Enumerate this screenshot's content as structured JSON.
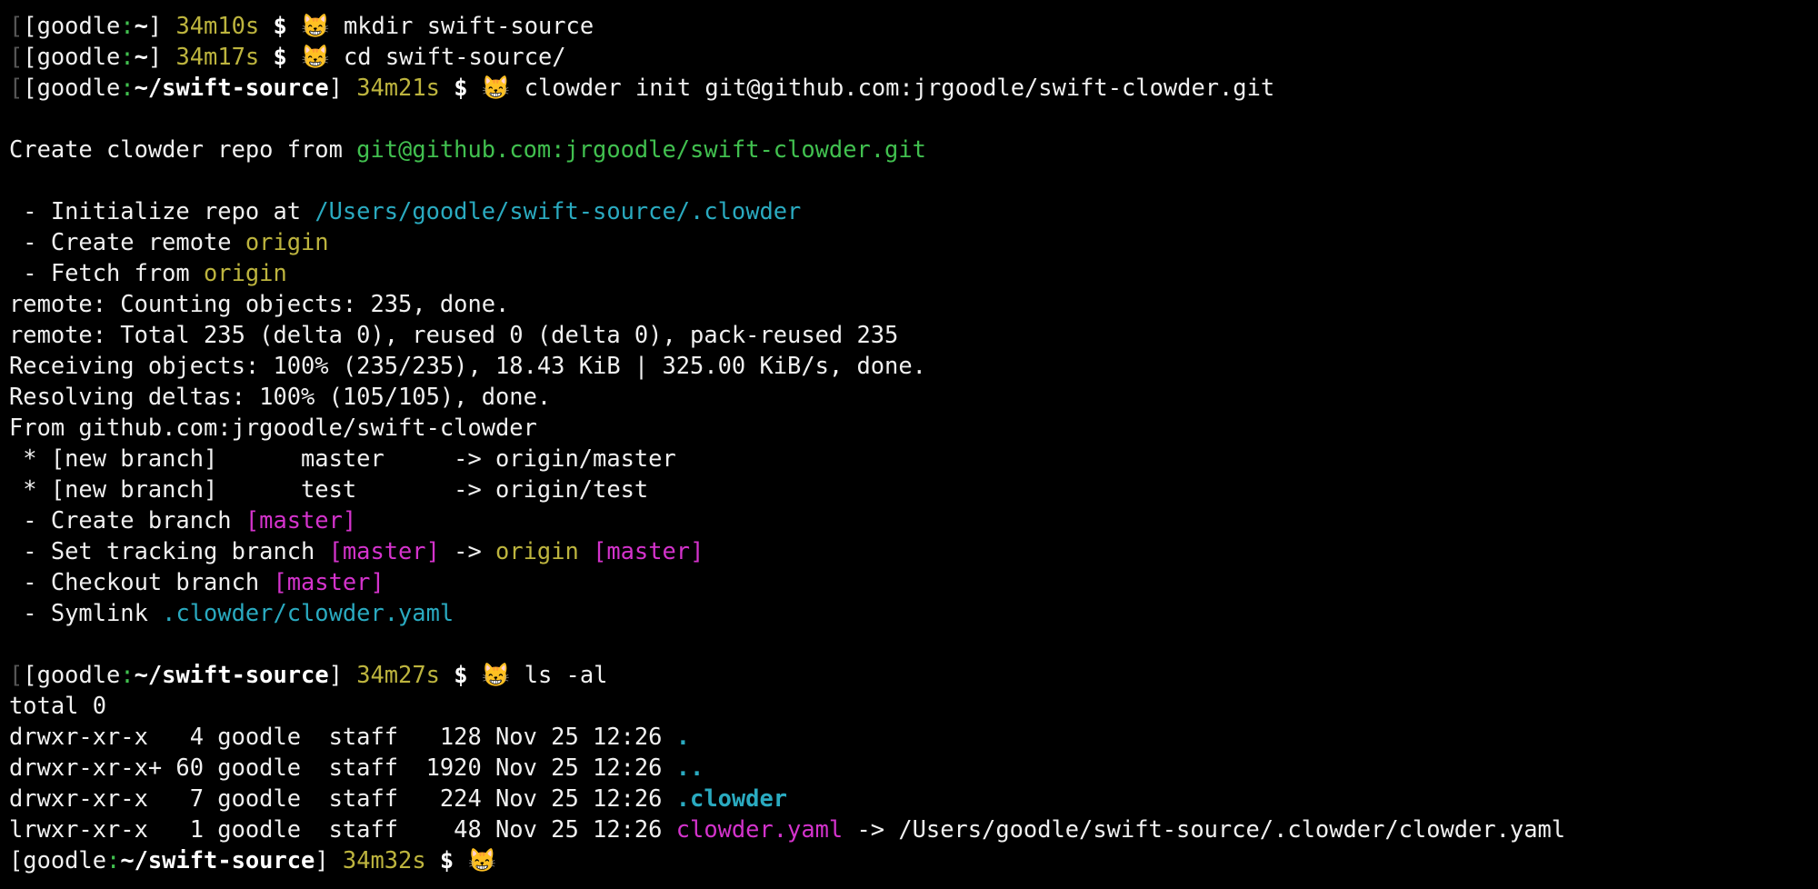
{
  "colors": {
    "background": "#000000",
    "foreground": "#f0f0f0",
    "green": "#41c04f",
    "yellow": "#bdb43e",
    "teal": "#2aaac0",
    "magenta": "#d433cc",
    "emoji": "#f2b520"
  },
  "lines": [
    [
      {
        "t": "[",
        "c": "dim"
      },
      {
        "t": "[goodle",
        "c": "w"
      },
      {
        "t": ":",
        "c": "g"
      },
      {
        "t": "~",
        "c": "wb"
      },
      {
        "t": "] ",
        "c": "w"
      },
      {
        "t": "34m10s",
        "c": "y"
      },
      {
        "t": " $ ",
        "c": "wb"
      },
      {
        "t": "😸",
        "c": "emoji",
        "icon": "grinning-cat-icon"
      },
      {
        "t": " mkdir swift-source",
        "c": "w"
      }
    ],
    [
      {
        "t": "[",
        "c": "dim"
      },
      {
        "t": "[goodle",
        "c": "w"
      },
      {
        "t": ":",
        "c": "g"
      },
      {
        "t": "~",
        "c": "wb"
      },
      {
        "t": "] ",
        "c": "w"
      },
      {
        "t": "34m17s",
        "c": "y"
      },
      {
        "t": " $ ",
        "c": "wb"
      },
      {
        "t": "😸",
        "c": "emoji",
        "icon": "grinning-cat-icon"
      },
      {
        "t": " cd swift-source/",
        "c": "w"
      }
    ],
    [
      {
        "t": "[",
        "c": "dim"
      },
      {
        "t": "[goodle",
        "c": "w"
      },
      {
        "t": ":",
        "c": "g"
      },
      {
        "t": "~/swift-source",
        "c": "wb"
      },
      {
        "t": "] ",
        "c": "w"
      },
      {
        "t": "34m21s",
        "c": "y"
      },
      {
        "t": " $ ",
        "c": "wb"
      },
      {
        "t": "😸",
        "c": "emoji",
        "icon": "grinning-cat-icon"
      },
      {
        "t": " clowder init git@github.com:jrgoodle/swift-clowder.git",
        "c": "w"
      }
    ],
    [],
    [
      {
        "t": "Create clowder repo from ",
        "c": "w"
      },
      {
        "t": "git@github.com:jrgoodle/swift-clowder.git",
        "c": "g"
      }
    ],
    [],
    [
      {
        "t": " - Initialize repo at ",
        "c": "w"
      },
      {
        "t": "/Users/goodle/swift-source/.clowder",
        "c": "t"
      }
    ],
    [
      {
        "t": " - Create remote ",
        "c": "w"
      },
      {
        "t": "origin",
        "c": "y"
      }
    ],
    [
      {
        "t": " - Fetch from ",
        "c": "w"
      },
      {
        "t": "origin",
        "c": "y"
      }
    ],
    [
      {
        "t": "remote: Counting objects: 235, done.",
        "c": "w"
      }
    ],
    [
      {
        "t": "remote: Total 235 (delta 0), reused 0 (delta 0), pack-reused 235",
        "c": "w"
      }
    ],
    [
      {
        "t": "Receiving objects: 100% (235/235), 18.43 KiB | 325.00 KiB/s, done.",
        "c": "w"
      }
    ],
    [
      {
        "t": "Resolving deltas: 100% (105/105), done.",
        "c": "w"
      }
    ],
    [
      {
        "t": "From github.com:jrgoodle/swift-clowder",
        "c": "w"
      }
    ],
    [
      {
        "t": " * [new branch]      master     -> origin/master",
        "c": "w"
      }
    ],
    [
      {
        "t": " * [new branch]      test       -> origin/test",
        "c": "w"
      }
    ],
    [
      {
        "t": " - Create branch ",
        "c": "w"
      },
      {
        "t": "[master]",
        "c": "m"
      }
    ],
    [
      {
        "t": " - Set tracking branch ",
        "c": "w"
      },
      {
        "t": "[master]",
        "c": "m"
      },
      {
        "t": " -> ",
        "c": "w"
      },
      {
        "t": "origin",
        "c": "y"
      },
      {
        "t": " ",
        "c": "w"
      },
      {
        "t": "[master]",
        "c": "m"
      }
    ],
    [
      {
        "t": " - Checkout branch ",
        "c": "w"
      },
      {
        "t": "[master]",
        "c": "m"
      }
    ],
    [
      {
        "t": " - Symlink ",
        "c": "w"
      },
      {
        "t": ".clowder/clowder.yaml",
        "c": "t"
      }
    ],
    [],
    [
      {
        "t": "[",
        "c": "dim"
      },
      {
        "t": "[goodle",
        "c": "w"
      },
      {
        "t": ":",
        "c": "g"
      },
      {
        "t": "~/swift-source",
        "c": "wb"
      },
      {
        "t": "] ",
        "c": "w"
      },
      {
        "t": "34m27s",
        "c": "y"
      },
      {
        "t": " $ ",
        "c": "wb"
      },
      {
        "t": "😸",
        "c": "emoji",
        "icon": "grinning-cat-icon"
      },
      {
        "t": " ls -al",
        "c": "w"
      }
    ],
    [
      {
        "t": "total 0",
        "c": "w"
      }
    ],
    [
      {
        "t": "drwxr-xr-x   4 goodle  staff   128 Nov 25 12:26 ",
        "c": "w"
      },
      {
        "t": ".",
        "c": "tb"
      }
    ],
    [
      {
        "t": "drwxr-xr-x+ 60 goodle  staff  1920 Nov 25 12:26 ",
        "c": "w"
      },
      {
        "t": "..",
        "c": "tb"
      }
    ],
    [
      {
        "t": "drwxr-xr-x   7 goodle  staff   224 Nov 25 12:26 ",
        "c": "w"
      },
      {
        "t": ".clowder",
        "c": "tb"
      }
    ],
    [
      {
        "t": "lrwxr-xr-x   1 goodle  staff    48 Nov 25 12:26 ",
        "c": "w"
      },
      {
        "t": "clowder.yaml",
        "c": "m"
      },
      {
        "t": " -> /Users/goodle/swift-source/.clowder/clowder.yaml",
        "c": "w"
      }
    ],
    [
      {
        "t": "[goodle",
        "c": "w"
      },
      {
        "t": ":",
        "c": "g"
      },
      {
        "t": "~/swift-source",
        "c": "wb"
      },
      {
        "t": "] ",
        "c": "w"
      },
      {
        "t": "34m32s",
        "c": "y"
      },
      {
        "t": " $ ",
        "c": "wb"
      },
      {
        "t": "😸",
        "c": "emoji",
        "icon": "grinning-cat-icon"
      }
    ]
  ]
}
